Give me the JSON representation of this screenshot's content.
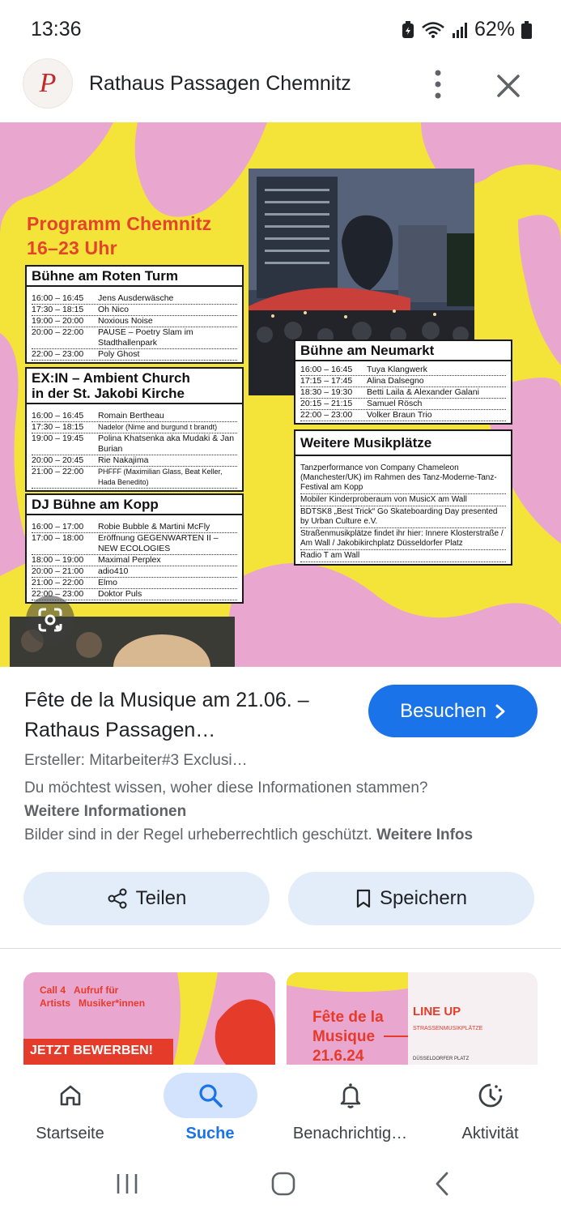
{
  "status_bar": {
    "time": "13:36",
    "battery": "62%"
  },
  "header": {
    "title": "Rathaus Passagen Chemnitz",
    "logo_letter": "P"
  },
  "poster": {
    "title_line1": "Programm Chemnitz",
    "title_line2": "16–23 Uhr",
    "stage1": {
      "name": "Bühne am Roten Turm",
      "rows": [
        {
          "time": "16:00 – 16:45",
          "act": "Jens Ausderwäsche"
        },
        {
          "time": "17:30 – 18:15",
          "act": "Oh Nico"
        },
        {
          "time": "19:00 – 20:00",
          "act": "Noxious Noise"
        },
        {
          "time": "20:00 – 22:00",
          "act": "PAUSE – Poetry Slam im Stadthallenpark"
        },
        {
          "time": "22:00 – 23:00",
          "act": "Poly Ghost"
        }
      ]
    },
    "stage2": {
      "name_line1": "EX:IN – Ambient Church",
      "name_line2": "in der St. Jakobi Kirche",
      "rows": [
        {
          "time": "16:00 – 16:45",
          "act": "Romain Bertheau"
        },
        {
          "time": "17:30 – 18:15",
          "act": "Nadelor (Nime and burgund t brandt)"
        },
        {
          "time": "19:00 – 19:45",
          "act": "Polina Khatsenka aka Mudaki & Jan Burian"
        },
        {
          "time": "20:00 – 20:45",
          "act": "Rie Nakajima"
        },
        {
          "time": "21:00 – 22:00",
          "act": "PHFFF (Maximilian Glass, Beat Keller, Hada Benedito)"
        }
      ]
    },
    "stage3": {
      "name": "DJ Bühne am Kopp",
      "rows": [
        {
          "time": "16:00 – 17:00",
          "act": "Robie Bubble & Martini McFly"
        },
        {
          "time": "17:00 – 18:00",
          "act": "Eröffnung GEGENWARTEN II – NEW ECOLOGIES"
        },
        {
          "time": "18:00 – 19:00",
          "act": "Maximal Perplex"
        },
        {
          "time": "20:00 – 21:00",
          "act": "adio410"
        },
        {
          "time": "21:00 – 22:00",
          "act": "Elmo"
        },
        {
          "time": "22:00 – 23:00",
          "act": "Doktor Puls"
        }
      ]
    },
    "stage4": {
      "name": "Bühne am Neumarkt",
      "rows": [
        {
          "time": "16:00 – 16:45",
          "act": "Tuya Klangwerk"
        },
        {
          "time": "17:15 – 17:45",
          "act": "Alina Dalsegno"
        },
        {
          "time": "18:30 – 19:30",
          "act": "Betti Laila & Alexander Galani"
        },
        {
          "time": "20:15 – 21:15",
          "act": "Samuel Rösch"
        },
        {
          "time": "22:00 – 23:00",
          "act": "Volker Braun Trio"
        }
      ]
    },
    "stage5": {
      "name": "Weitere Musikplätze",
      "notes": [
        "Tanzperformance von Company Chameleon (Manchester/UK) im Rahmen des Tanz-Moderne-Tanz-Festival am Kopp",
        "Mobiler Kinderproberaum von MusicX am Wall",
        "BDTSK8 „Best Trick“ Go Skateboarding Day presented by Urban Culture e.V.",
        "Straßenmusikplätze findet ihr hier: Innere Klosterstraße / Am Wall / Jakobikirchplatz Düsseldorfer Platz",
        "Radio T am Wall"
      ]
    }
  },
  "result": {
    "title": "Fête de la Musique am 21.06. – Rathaus Passagen…",
    "visit_label": "Besuchen",
    "creator": "Ersteller: Mitarbeiter#3 Exclusi…",
    "info_question": "Du möchtest wissen, woher diese Informationen stammen?",
    "info_link": "Weitere Informationen",
    "copyright_text": "Bilder sind in der Regel urheberrechtlich geschützt. ",
    "copyright_link": "Weitere Infos"
  },
  "actions": {
    "share_label": "Teilen",
    "save_label": "Speichern"
  },
  "thumbnails": {
    "left": {
      "line1a": "Call 4",
      "line1b": "Aufruf für",
      "line2a": "Artists",
      "line2b": "Musiker*innen",
      "banner": "JETZT BEWERBEN!"
    },
    "right": {
      "title1": "Fête de la",
      "title2": "Musique",
      "title3": "21.6.24",
      "lineup": "LINE UP",
      "sub": "STRASSENMUSIKPLÄTZE",
      "foot": "DÜSSELDORFER PLATZ"
    }
  },
  "bottom_nav": [
    {
      "label": "Startseite",
      "icon": "home-icon"
    },
    {
      "label": "Suche",
      "icon": "search-icon"
    },
    {
      "label": "Benachrichtig…",
      "icon": "bell-icon"
    },
    {
      "label": "Aktivität",
      "icon": "activity-icon"
    }
  ],
  "colors": {
    "accent": "#1a73e8",
    "poster_yellow": "#f4e43a",
    "poster_pink": "#e9a6cf",
    "poster_red": "#e5432b"
  }
}
